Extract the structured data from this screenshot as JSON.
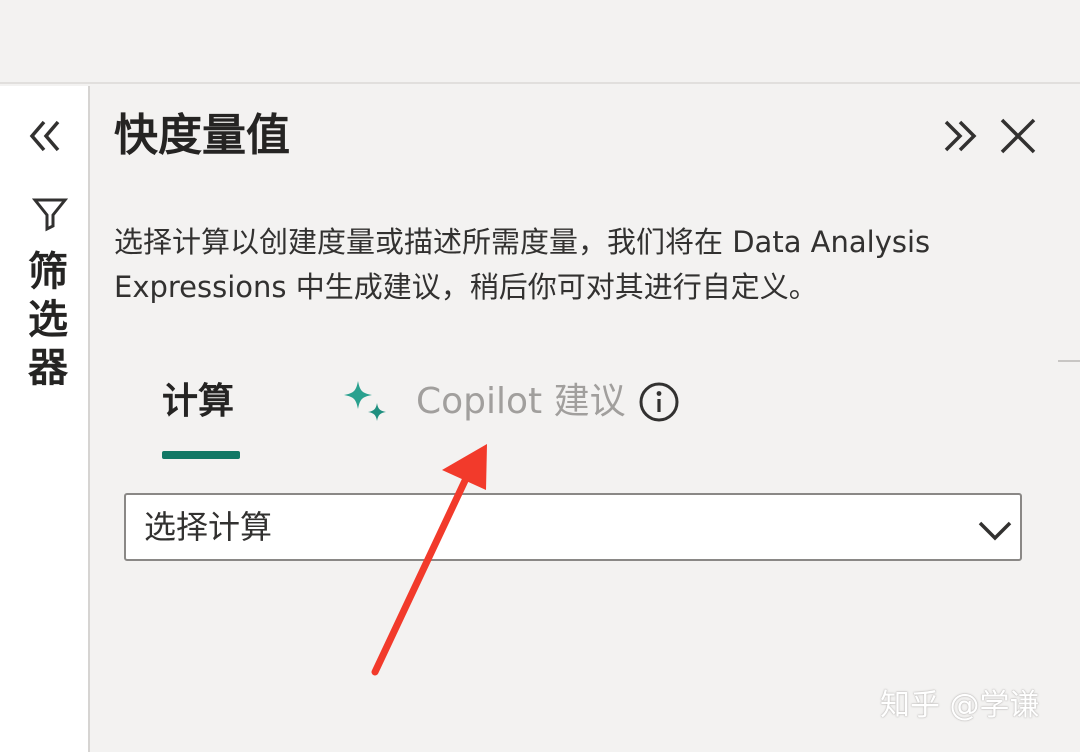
{
  "filters_pane": {
    "label_chars": [
      "筛",
      "选",
      "器"
    ],
    "collapse_icon": "double-chevron-left-icon",
    "filter_icon": "funnel-icon"
  },
  "panel": {
    "title": "快度量值",
    "expand_icon": "double-chevron-right-icon",
    "close_icon": "close-icon",
    "description": "选择计算以创建度量或描述所需度量，我们将在 Data Analysis Expressions 中生成建议，稍后你可对其进行自定义。",
    "tabs": [
      {
        "label": "计算",
        "selected": true
      },
      {
        "label": "Copilot 建议",
        "selected": false,
        "icon": "sparkle-icon",
        "info_icon": "info-icon"
      }
    ],
    "select": {
      "value": "选择计算",
      "icon": "chevron-down-icon"
    }
  },
  "watermark": "知乎 @学谦",
  "colors": {
    "accent": "#117865",
    "copilot_sparkle": "#2aa18f",
    "annotation_arrow": "#f23a2b",
    "muted_text": "#a19f9d"
  }
}
